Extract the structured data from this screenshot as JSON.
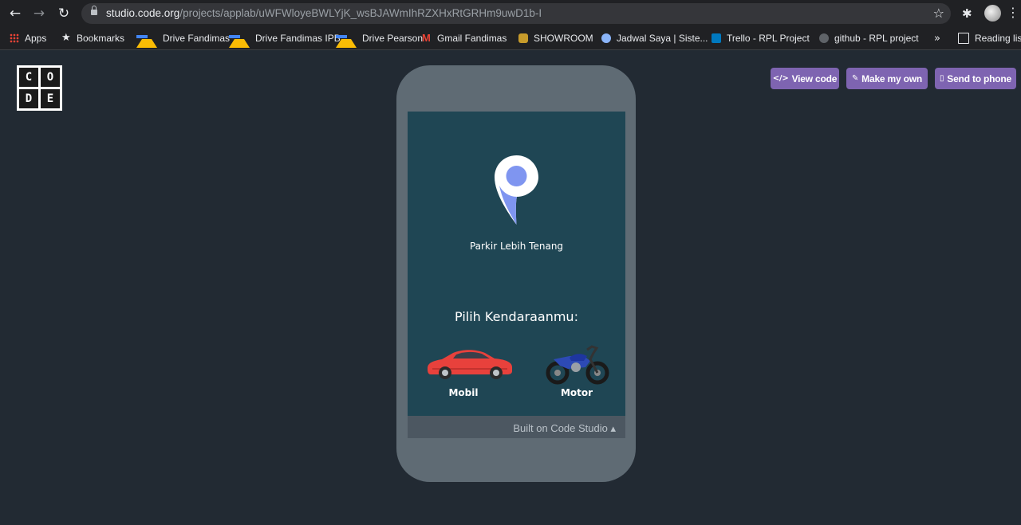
{
  "browser": {
    "url_host": "studio.code.org",
    "url_path": "/projects/applab/uWFWloyeBWLYjK_wsBJAWmIhRZXHxRtGRHm9uwD1b-I",
    "nav_back": "←",
    "nav_forward": "→",
    "nav_reload": "↻",
    "bookmark_star": "☆",
    "extensions_icon": "✱",
    "menu": "⋮"
  },
  "bookmarks": [
    {
      "label": "Apps",
      "icon": "apps-grid-icon"
    },
    {
      "label": "Bookmarks",
      "icon": "star-icon"
    },
    {
      "label": "Drive Fandimas",
      "icon": "google-drive-icon"
    },
    {
      "label": "Drive Fandimas IPB",
      "icon": "google-drive-icon"
    },
    {
      "label": "Drive Pearson",
      "icon": "google-drive-icon"
    },
    {
      "label": "Gmail Fandimas",
      "icon": "gmail-icon"
    },
    {
      "label": "SHOWROOM",
      "icon": "showroom-icon"
    },
    {
      "label": "Jadwal Saya | Siste...",
      "icon": "jadwal-icon"
    },
    {
      "label": "Trello - RPL Project",
      "icon": "trello-icon"
    },
    {
      "label": "github - RPL project",
      "icon": "github-icon"
    }
  ],
  "bookmarks_overflow": "»",
  "reading_list": "Reading list",
  "page": {
    "logo_letters": [
      "C",
      "O",
      "D",
      "E"
    ],
    "buttons": {
      "view_code": "View code",
      "view_code_icon": "</>",
      "make_my_own": "Make my own",
      "make_my_own_icon": "✎",
      "send_to_phone": "Send to phone",
      "send_to_phone_icon": "▯"
    }
  },
  "app": {
    "tagline": "Parkir Lebih Tenang",
    "heading": "Pilih Kendaraanmu:",
    "car_label": "Mobil",
    "moto_label": "Motor",
    "footer": "Built on Code Studio ▴"
  },
  "colors": {
    "background": "#222a33",
    "screen": "#1f4654",
    "button": "#7e64b1",
    "pin": "#ffffff",
    "pin_accent": "#7f95f0"
  }
}
